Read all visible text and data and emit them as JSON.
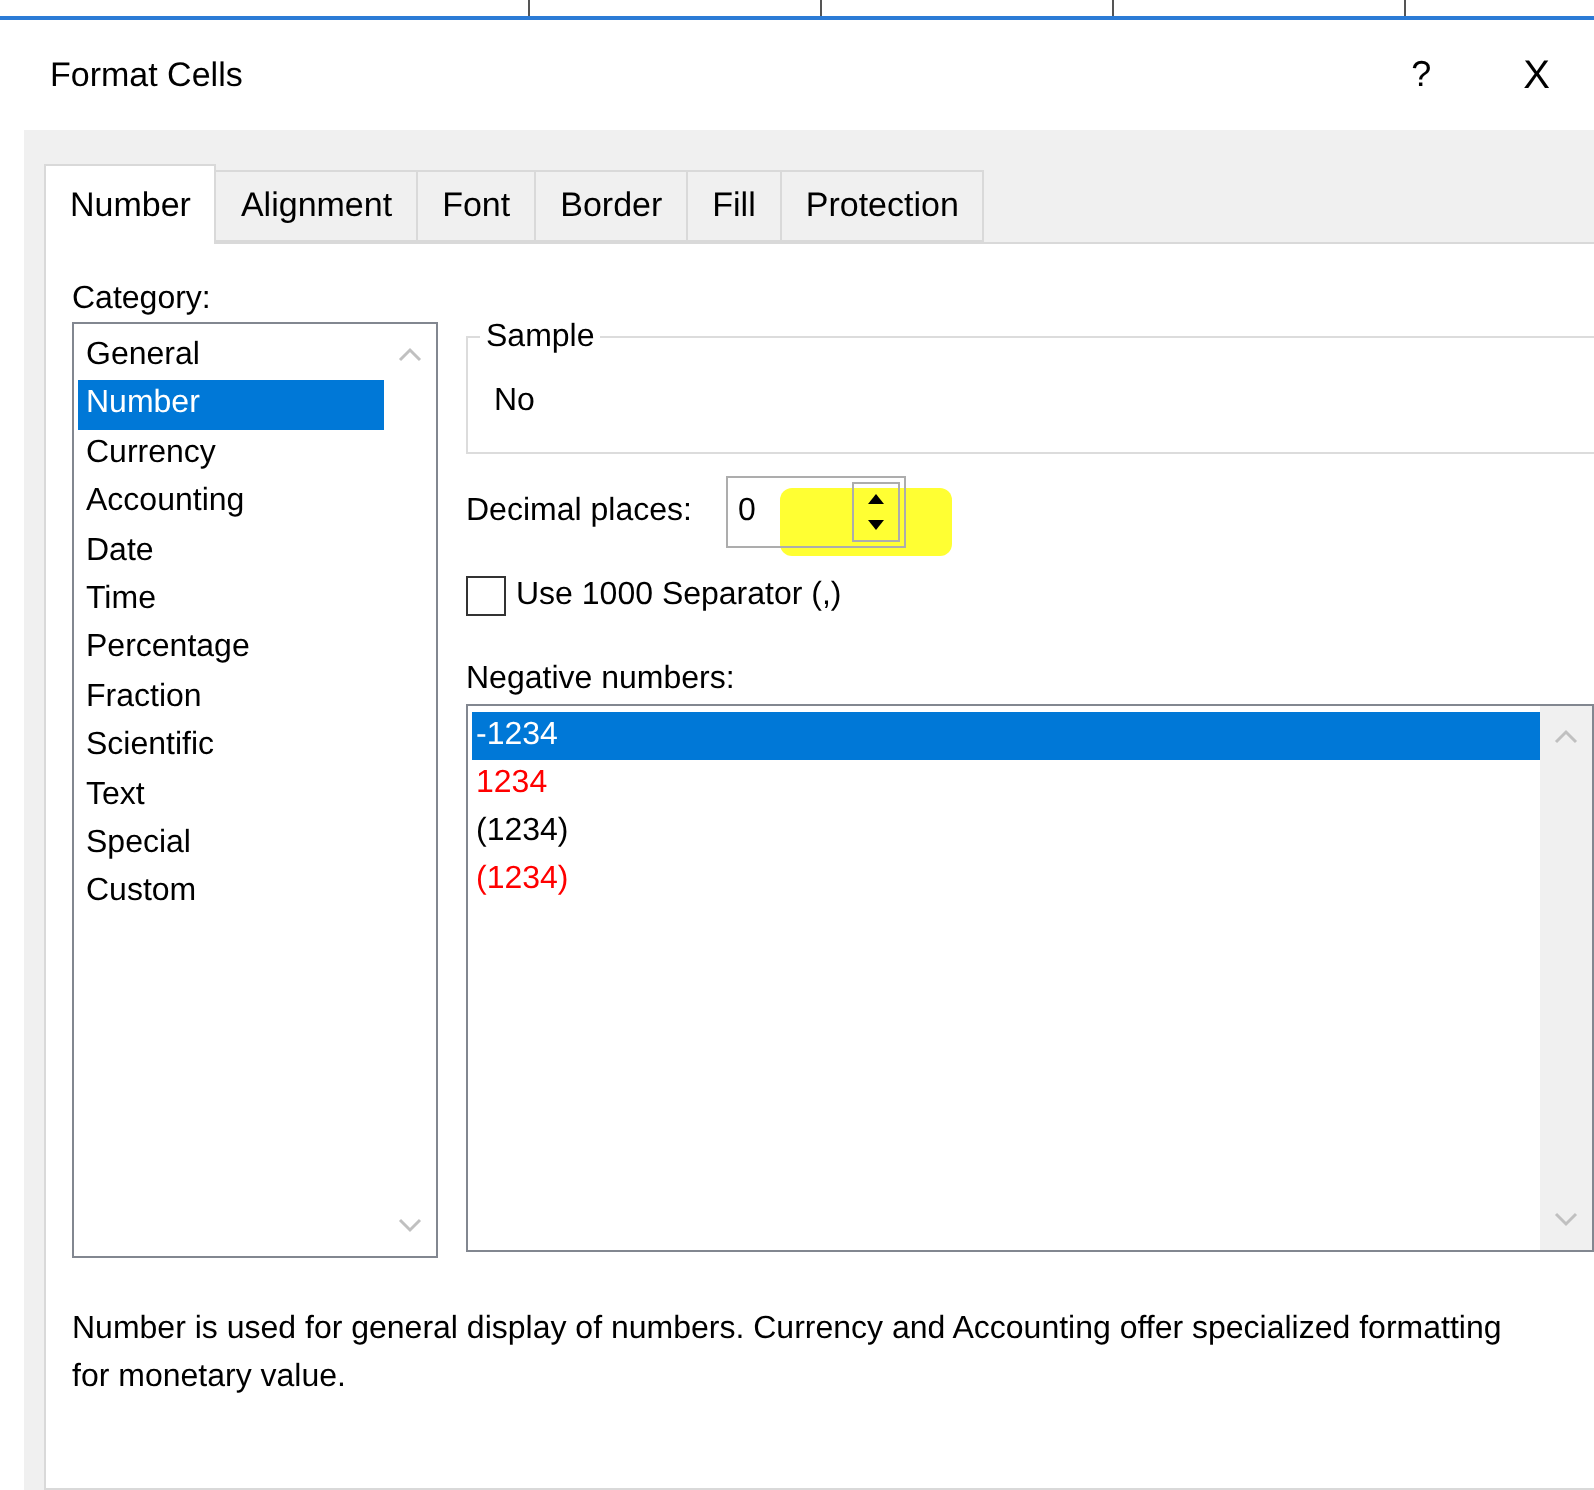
{
  "window": {
    "title": "Format Cells",
    "help": "?",
    "close": "X"
  },
  "tabs": [
    {
      "label": "Number",
      "selected": true
    },
    {
      "label": "Alignment",
      "selected": false
    },
    {
      "label": "Font",
      "selected": false
    },
    {
      "label": "Border",
      "selected": false
    },
    {
      "label": "Fill",
      "selected": false
    },
    {
      "label": "Protection",
      "selected": false
    }
  ],
  "category": {
    "label": "Category:",
    "items": [
      {
        "label": "General",
        "selected": false
      },
      {
        "label": "Number",
        "selected": true
      },
      {
        "label": "Currency",
        "selected": false
      },
      {
        "label": "Accounting",
        "selected": false
      },
      {
        "label": "Date",
        "selected": false
      },
      {
        "label": "Time",
        "selected": false
      },
      {
        "label": "Percentage",
        "selected": false
      },
      {
        "label": "Fraction",
        "selected": false
      },
      {
        "label": "Scientific",
        "selected": false
      },
      {
        "label": "Text",
        "selected": false
      },
      {
        "label": "Special",
        "selected": false
      },
      {
        "label": "Custom",
        "selected": false
      }
    ]
  },
  "sample": {
    "label": "Sample",
    "value": "No"
  },
  "decimal_places": {
    "label": "Decimal places:",
    "value": "0",
    "highlighted": true
  },
  "separator": {
    "label": "Use 1000 Separator (,)",
    "checked": false
  },
  "negative_numbers": {
    "label": "Negative numbers:",
    "items": [
      {
        "label": "-1234",
        "color": "#ffffff",
        "selected": true
      },
      {
        "label": "1234",
        "color": "#ff0000",
        "selected": false
      },
      {
        "label": "(1234)",
        "color": "#000000",
        "selected": false
      },
      {
        "label": "(1234)",
        "color": "#ff0000",
        "selected": false
      }
    ]
  },
  "description": "Number is used for general display of numbers.  Currency and Accounting offer specialized formatting for monetary value."
}
